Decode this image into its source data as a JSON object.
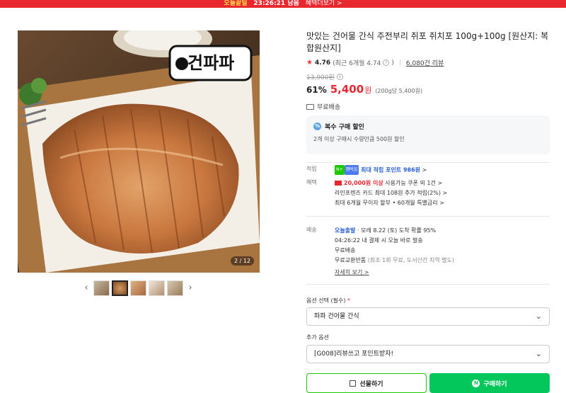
{
  "banner": {
    "highlight": "오늘끝딜",
    "time": "23:26:21 남음",
    "more": "혜택더보기 >"
  },
  "gallery": {
    "logo_text": "건파파",
    "counter": "2 / 12",
    "thumb_count": 5,
    "active_thumb": 2,
    "prev_arrow": "‹",
    "next_arrow": "›"
  },
  "product": {
    "title": "맛있는 건어물 간식 주전부리 쥐포 쥐치포 100g+100g [원산지: 복합원산지]",
    "rating": "4.76",
    "rating_recent": "(최근 6개월 4.74",
    "rating_recent_end": ")",
    "reviews": "6,080건 리뷰",
    "original_price": "13,900원",
    "discount": "61%",
    "price": "5,400",
    "price_won": "원",
    "unit_price": "(200g당 5,400원)",
    "shipping": "무료배송"
  },
  "promo": {
    "icon": "%",
    "title": "복수 구매 할인",
    "desc": "2개 이상 구매시 수량만큼 500원 할인"
  },
  "points": {
    "label": "적립",
    "badge1": "N+",
    "badge2": "멤버십",
    "text": "최대 적립 포인트 986원",
    "arrow": ">"
  },
  "benefit": {
    "label": "혜택",
    "line1_red": "20,000원 이상",
    "line1_rest": "사용가능 쿠폰 외 1건 >",
    "line2": "라인프렌즈 카드 최대 108원 추가 적립(2%) >",
    "line3": "최대 6개월 무이자 할부 • 60개월 특별금리 >"
  },
  "delivery": {
    "label": "배송",
    "today": "오늘출발",
    "line1_rest": "· 모레 8.22 (토) 도착 확률 95%",
    "line2": "04:26:22  내 결제 시 오늘 바로 발송",
    "line3": "무료배송",
    "line4_main": "무료교환반품",
    "line4_sub": "(최초 1회 무료, 도서산간 지역 별도)",
    "more": "자세히 보기 >"
  },
  "options": {
    "label": "옵션 선택 (필수)",
    "required_mark": "*",
    "selected": "파파 건어물 간식",
    "extra_label": "추가 옵션",
    "extra_selected": "[G008]리뷰쓰고 포인트받자!",
    "chevron": "⌄"
  },
  "buttons": {
    "gift": "선물하기",
    "buy": "구매하기",
    "buy_icon": "N"
  },
  "colors": {
    "accent_red": "#e8272f",
    "naver_green": "#03c75a"
  }
}
